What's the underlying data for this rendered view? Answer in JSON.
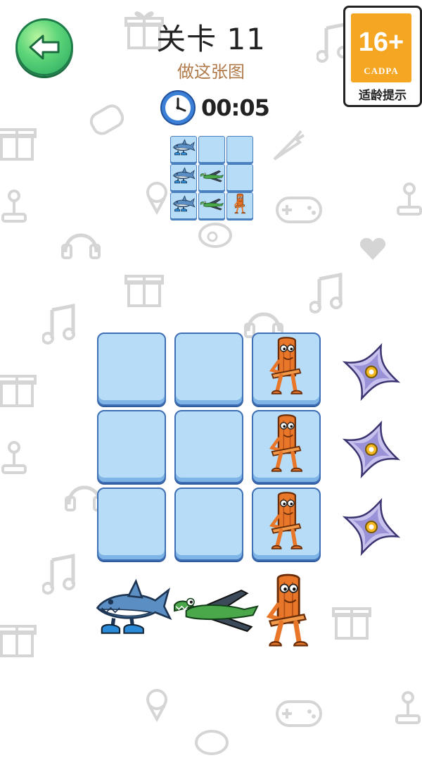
{
  "header": {
    "level_title": "关卡 11",
    "subtitle": "做这张图",
    "timer": "00:05"
  },
  "age_badge": {
    "rating": "16+",
    "org": "CADPA",
    "tip": "适龄提示"
  },
  "target_pattern": [
    [
      "shark",
      "empty",
      "empty"
    ],
    [
      "shark",
      "croc-plane",
      "empty"
    ],
    [
      "shark",
      "croc-plane",
      "wood-man"
    ]
  ],
  "board": [
    [
      "empty",
      "empty",
      "wood-man"
    ],
    [
      "empty",
      "empty",
      "wood-man"
    ],
    [
      "empty",
      "empty",
      "wood-man"
    ]
  ],
  "row_actions": [
    "shuriken-icon",
    "shuriken-icon",
    "shuriken-icon"
  ],
  "characters": [
    "shark-with-sneakers",
    "crocodile-airplane",
    "wooden-stick-man"
  ],
  "colors": {
    "tile": "#b7dcf7",
    "tile_border": "#3f6fb5",
    "back_button": "#5fd67a",
    "subtitle": "#b07a4a",
    "badge": "#f5a623"
  }
}
